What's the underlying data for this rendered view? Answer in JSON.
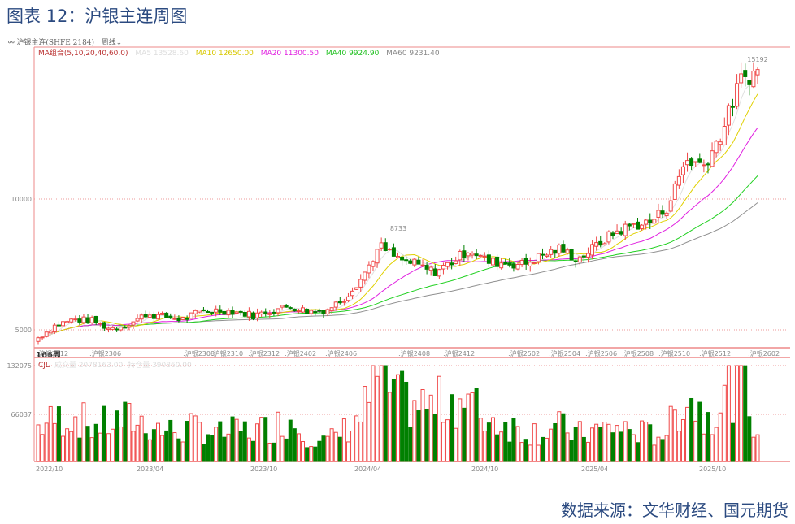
{
  "title": "图表 12：沪银主连周图",
  "source": "数据来源：文华财经、国元期货",
  "header": {
    "icon": "link-icon",
    "instrument": "沪银主连(SHFE 2184)",
    "period": "周线"
  },
  "ma_legend": {
    "label": "MA组合(5,10,20,40,60,0)",
    "ma5": "MA5 13528.60",
    "ma10": "MA10 12650.00",
    "ma20": "MA20 11300.50",
    "ma40": "MA40 9924.90",
    "ma60": "MA60 9231.40"
  },
  "colors": {
    "up": "#f04848",
    "down": "#008000",
    "ma5": "#e0e0e0",
    "ma10": "#e0d000",
    "ma20": "#e020e0",
    "ma40": "#20d020",
    "ma60": "#909090",
    "title": "#2b4a80"
  },
  "volume_panel": {
    "label": "CJL",
    "volume": "成交量 2078163.00",
    "open_interest": "持仓量 390860.00",
    "unit_label": "166周"
  },
  "chart_data": {
    "type": "candlestick",
    "price_labels": {
      "high": "15192",
      "mid_high": "8733",
      "y10000": "10000",
      "y5000": "5000"
    },
    "y_ticks": [
      5000,
      10000
    ],
    "vol_ticks": [
      "132075",
      "66037"
    ],
    "contract_labels": [
      "沪银2212",
      "沪银2306",
      "沪银2308",
      "沪银2310",
      "沪银2312",
      "沪银2402",
      "沪银2406",
      "沪银2408",
      "沪银2412",
      "沪银2502",
      "沪银2504",
      "沪银2506",
      "沪银2508",
      "沪银2510",
      "沪银2512",
      "沪银2602"
    ],
    "x_ticks": [
      "2022/10",
      "2023/04",
      "2023/10",
      "2024/04",
      "2024/10",
      "2025/04",
      "2025/10"
    ],
    "monthly_close": [
      4700,
      5200,
      5400,
      5350,
      5050,
      5200,
      5600,
      5500,
      5400,
      5700,
      5750,
      5700,
      5550,
      5750,
      5900,
      5700,
      5750,
      6200,
      7000,
      8200,
      7700,
      7500,
      7200,
      7600,
      8100,
      7600,
      7550,
      7500,
      7850,
      8100,
      7700,
      8200,
      8700,
      9000,
      9100,
      9700,
      11500,
      11300,
      12500,
      14500,
      14900
    ],
    "monthly_volume_level": [
      45,
      55,
      60,
      45,
      50,
      55,
      50,
      40,
      40,
      45,
      35,
      40,
      40,
      45,
      55,
      35,
      25,
      40,
      60,
      120,
      80,
      75,
      70,
      85,
      75,
      55,
      50,
      40,
      40,
      45,
      35,
      40,
      45,
      40,
      35,
      40,
      90,
      60,
      80,
      110,
      40
    ]
  }
}
